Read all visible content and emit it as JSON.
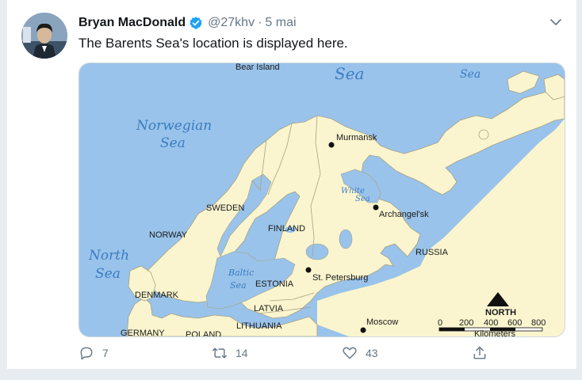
{
  "tweet": {
    "author_name": "Bryan MacDonald",
    "handle": "@27khv",
    "separator": "·",
    "date": "5 mai",
    "text": "The Barents Sea's location is displayed here.",
    "verified_icon": "verified-badge-icon",
    "menu_icon": "chevron-down-icon"
  },
  "map": {
    "labels": {
      "bear_island": "Bear Island",
      "sea_top": "Sea",
      "sea_top_right": "Sea",
      "norwegian": "Norwegian",
      "norwegian_sea": "Sea",
      "north": "North",
      "north_sea": "Sea",
      "white": "White",
      "white_sea": "Sea",
      "baltic": "Baltic",
      "baltic_sea": "Sea",
      "sweden": "SWEDEN",
      "norway": "NORWAY",
      "finland": "FINLAND",
      "russia": "RUSSIA",
      "estonia": "ESTONIA",
      "latvia": "LATVIA",
      "lithuania": "LITHUANIA",
      "denmark": "DENMARK",
      "germany": "GERMANY",
      "poland": "POLAND",
      "murmansk": "Murmansk",
      "archangelsk": "Archangel'sk",
      "st_petersburg": "St. Petersburg",
      "moscow": "Moscow",
      "compass": "NORTH",
      "scale_ticks": [
        "0",
        "200",
        "400",
        "600",
        "800"
      ],
      "scale_unit": "Kilometers"
    },
    "colors": {
      "sea": "#99c3ea",
      "land": "#fbf5cf",
      "border": "#a8a080"
    }
  },
  "actions": {
    "reply_count": "7",
    "retweet_count": "14",
    "like_count": "43",
    "reply_icon": "reply-icon",
    "retweet_icon": "retweet-icon",
    "like_icon": "heart-icon",
    "share_icon": "share-icon"
  }
}
